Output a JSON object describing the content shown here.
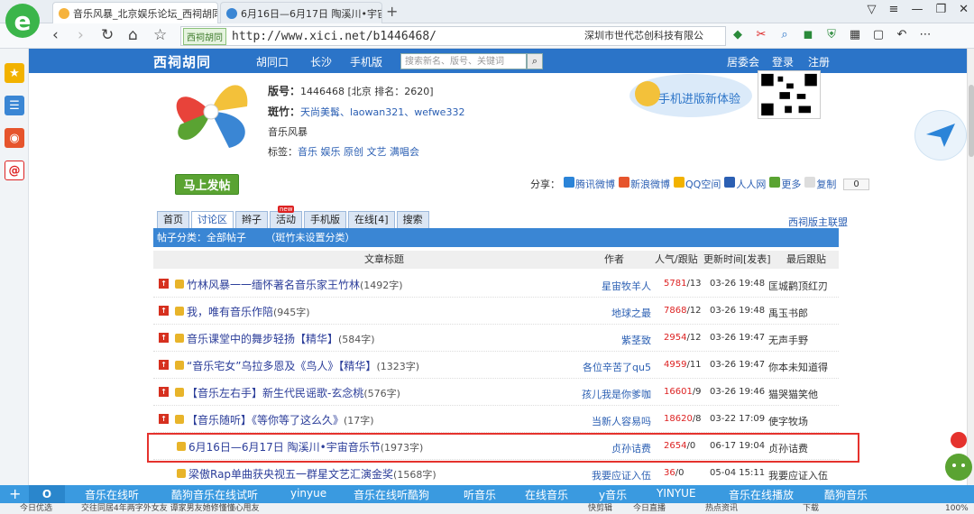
{
  "browser": {
    "tabs": [
      {
        "label": "音乐风暴_北京娱乐论坛_西祠胡同",
        "close": "×"
      },
      {
        "label": "6月16日—6月17日 陶溪川•宇宙",
        "close": "×"
      }
    ],
    "new_tab": "+",
    "address": {
      "site_badge": "西祠胡同",
      "url": "http://www.xici.net/b1446468/"
    },
    "company": "深圳市世代芯创科技有限公"
  },
  "site": {
    "brand": "西祠胡同",
    "nav": [
      "胡同口",
      "长沙",
      "手机版"
    ],
    "search_placeholder": "搜索新名、版号、关键词",
    "right": [
      "居委会",
      "登录",
      "注册"
    ]
  },
  "board": {
    "version_label": "版号：",
    "version_value": "1446468",
    "location": "[北京 排名：2620]",
    "mod_label": "斑竹：",
    "mods": "天尚美髯、laowan321、wefwe332",
    "name": "音乐风暴",
    "tags_label": "标签：",
    "tags": "音乐 娱乐 原创 文艺 满唱会",
    "promo": "手机进版新体验"
  },
  "post_button": "马上发帖",
  "share": {
    "label": "分享：",
    "items": [
      "腾讯微博",
      "新浪微博",
      "QQ空间",
      "人人网",
      "更多",
      "复制"
    ],
    "count": "0"
  },
  "forum_tabs": [
    "首页",
    "讨论区",
    "辫子",
    "活动",
    "手机版",
    "在线[4]",
    "搜索"
  ],
  "new_badge": "new",
  "mod_link": "西祠版主联盟",
  "category": {
    "label": "帖子分类：全部帖子",
    "note": "（斑竹未设置分类）"
  },
  "table_header": {
    "title": "文章标题",
    "author": "作者",
    "stats": "人气/跟贴",
    "updated": "更新时间[发表]",
    "last": "最后跟贴"
  },
  "posts": [
    {
      "title": "竹林风暴一一缅怀著名音乐家王竹林",
      "count": "(1492字)",
      "author": "星宙牧羊人",
      "views": "5781",
      "replies": "/13",
      "time": "03-26 19:48",
      "last": "匡城鹳顶红刃",
      "pinned": true
    },
    {
      "title": "我，唯有音乐作陪",
      "count": "(945字)",
      "author": "地球之最",
      "views": "7868",
      "replies": "/12",
      "time": "03-26 19:48",
      "last": "禹玉书郎",
      "pinned": true
    },
    {
      "title": "音乐课堂中的舞步轻扬【精华】",
      "count": "(584字)",
      "author": "紫茎致",
      "views": "2954",
      "replies": "/12",
      "time": "03-26 19:47",
      "last": "无声手野",
      "pinned": true
    },
    {
      "title": "“音乐宅女”乌拉多恩及《鸟人》【精华】",
      "count": "(1323字)",
      "author": "各位辛苦了qu5",
      "views": "4959",
      "replies": "/11",
      "time": "03-26 19:47",
      "last": "你本未知道得",
      "pinned": true
    },
    {
      "title": "【音乐左右手】新生代民谣歌-玄念桃",
      "count": "(576字)",
      "author": "孩儿我是你爹咖",
      "views": "16601",
      "replies": "/9",
      "time": "03-26 19:46",
      "last": "猫哭猫笑他",
      "pinned": true
    },
    {
      "title": "【音乐随听】《等你等了这么久》",
      "count": "(17字)",
      "author": "当新人容易吗",
      "views": "18620",
      "replies": "/8",
      "time": "03-22 17:09",
      "last": "使字牧场",
      "pinned": true
    },
    {
      "title": "6月16日—6月17日 陶溪川•宇宙音乐节",
      "count": "(1973字)",
      "author": "贞孙诘费",
      "views": "2654",
      "replies": "/0",
      "time": "06-17 19:04",
      "last": "贞孙诘费",
      "pinned": false
    },
    {
      "title": "梁傲Rap单曲获央视五一群星文艺汇演金奖",
      "count": "(1568字)",
      "author": "我要应证入伍",
      "views": "36",
      "replies": "/0",
      "time": "05-04 15:11",
      "last": "我要应证入伍",
      "pinned": false
    }
  ],
  "bottom_bar": {
    "links": [
      "音乐在线听",
      "酷狗音乐在线试听",
      "yinyue",
      "音乐在线听酷狗",
      "听音乐",
      "在线音乐",
      "y音乐",
      "YINYUE",
      "音乐在线播放",
      "酷狗音乐"
    ]
  },
  "status_bar": {
    "left": "今日优选",
    "news": "交往同居4年两字外女友 谭家男友她修懂懂心甩友",
    "right": [
      "快剪辑",
      "今日直播",
      "热点资讯",
      "下载",
      "100%"
    ]
  },
  "colors": {
    "accent": "#2b74c8",
    "highlight_border": "#e5322d",
    "post_green": "#5aa332"
  }
}
